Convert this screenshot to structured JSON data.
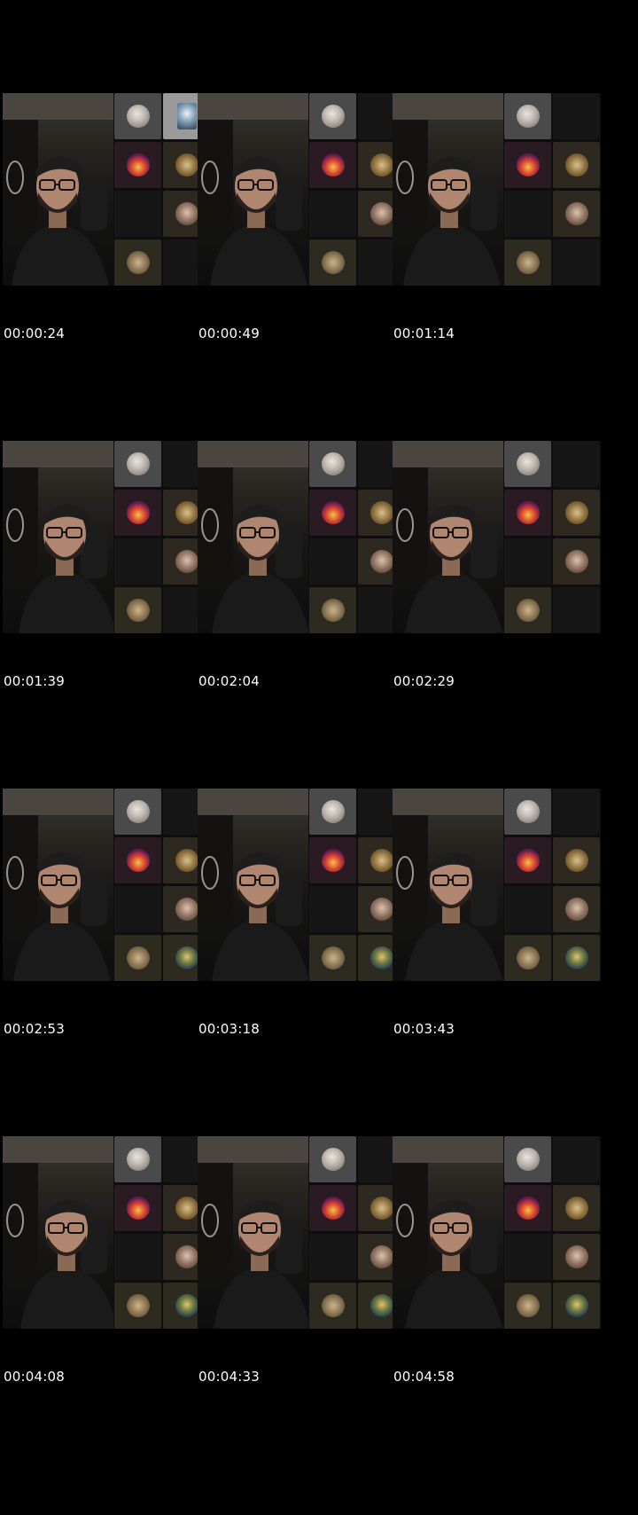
{
  "timestamps": [
    "00:00:24",
    "00:00:49",
    "00:01:14",
    "00:01:39",
    "00:02:04",
    "00:02:29",
    "00:02:53",
    "00:03:18",
    "00:03:43",
    "00:04:08",
    "00:04:33",
    "00:04:58"
  ],
  "participant_grid": {
    "tiles_per_frame": 8,
    "frames": [
      [
        "portrait",
        "man",
        "sunset",
        "gold",
        "blank",
        "woman",
        "lion",
        "blank"
      ],
      [
        "portrait",
        "blank",
        "sunset",
        "gold",
        "blank",
        "woman",
        "lion",
        "blank"
      ],
      [
        "portrait",
        "blank",
        "sunset",
        "gold",
        "blank",
        "woman",
        "lion",
        "blank"
      ],
      [
        "portrait",
        "blank",
        "sunset",
        "gold",
        "blank",
        "woman",
        "lion",
        "blank"
      ],
      [
        "portrait",
        "blank",
        "sunset",
        "gold",
        "blank",
        "woman",
        "lion",
        "blank"
      ],
      [
        "portrait",
        "blank",
        "sunset",
        "gold",
        "blank",
        "woman",
        "lion",
        "blank"
      ],
      [
        "portrait",
        "blank",
        "sunset",
        "gold",
        "blank",
        "woman",
        "lion",
        "mona"
      ],
      [
        "portrait",
        "blank",
        "sunset",
        "gold",
        "blank",
        "woman",
        "lion",
        "mona"
      ],
      [
        "portrait",
        "blank",
        "sunset",
        "gold",
        "blank",
        "woman",
        "lion",
        "mona"
      ],
      [
        "portrait",
        "blank",
        "sunset",
        "gold",
        "blank",
        "woman",
        "lion",
        "mona"
      ],
      [
        "portrait",
        "blank",
        "sunset",
        "gold",
        "blank",
        "woman",
        "lion",
        "mona"
      ],
      [
        "portrait",
        "blank",
        "sunset",
        "gold",
        "blank",
        "woman",
        "lion",
        "mona"
      ]
    ]
  },
  "colors": {
    "background": "#000000",
    "timestamp_text": "#ffffff"
  }
}
